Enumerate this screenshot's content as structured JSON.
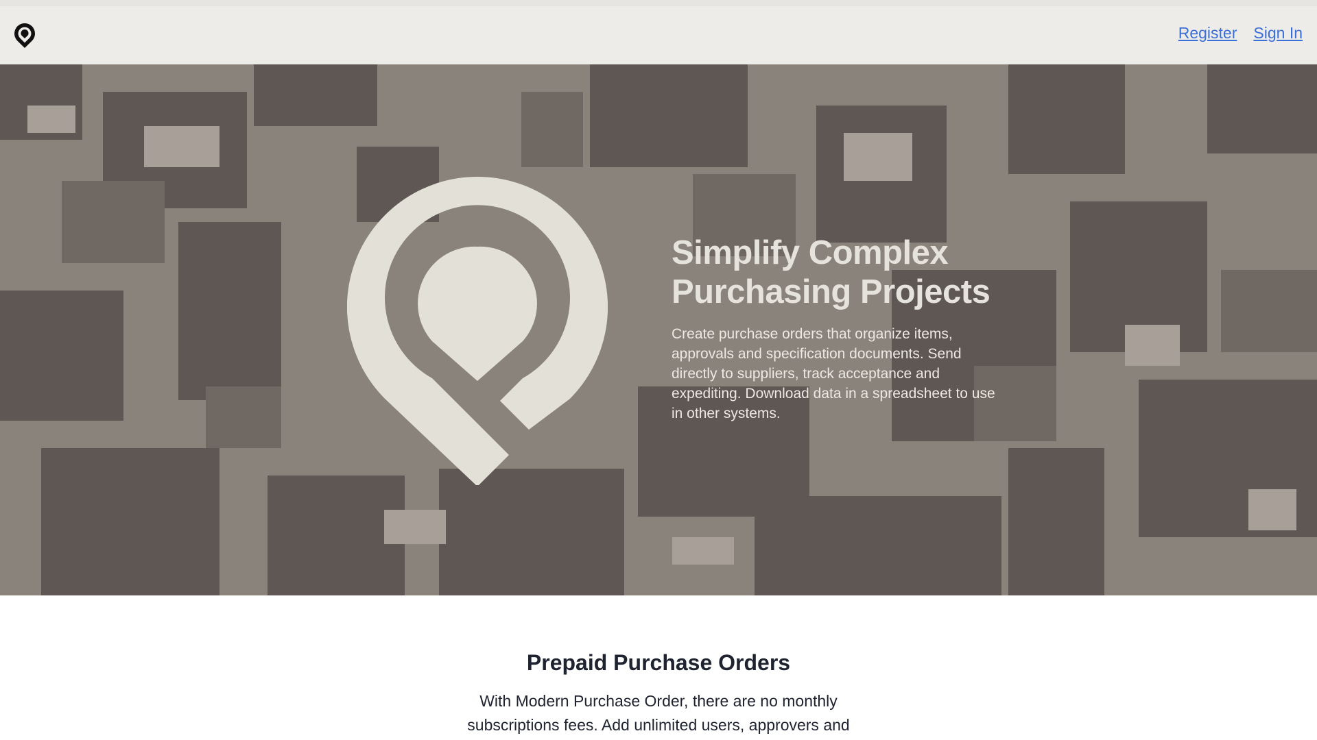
{
  "nav": {
    "logo_icon": "map-pin-logo-icon",
    "register_label": "Register",
    "signin_label": "Sign In",
    "link_color": "#3a6fd8"
  },
  "hero": {
    "background_color": "#8a837c",
    "logo_icon": "map-pin-logo-icon",
    "logo_color": "#e3e0d8",
    "title": "Simplify Complex Purchasing Projects",
    "description": "Create purchase orders that organize items, approvals and specification documents. Send directly to suppliers, track acceptance and expediting. Download data in a spreadsheet to use in other systems."
  },
  "section": {
    "title": "Prepaid Purchase Orders",
    "description": "With Modern Purchase Order, there are no monthly subscriptions fees. Add unlimited users, approvers and"
  }
}
